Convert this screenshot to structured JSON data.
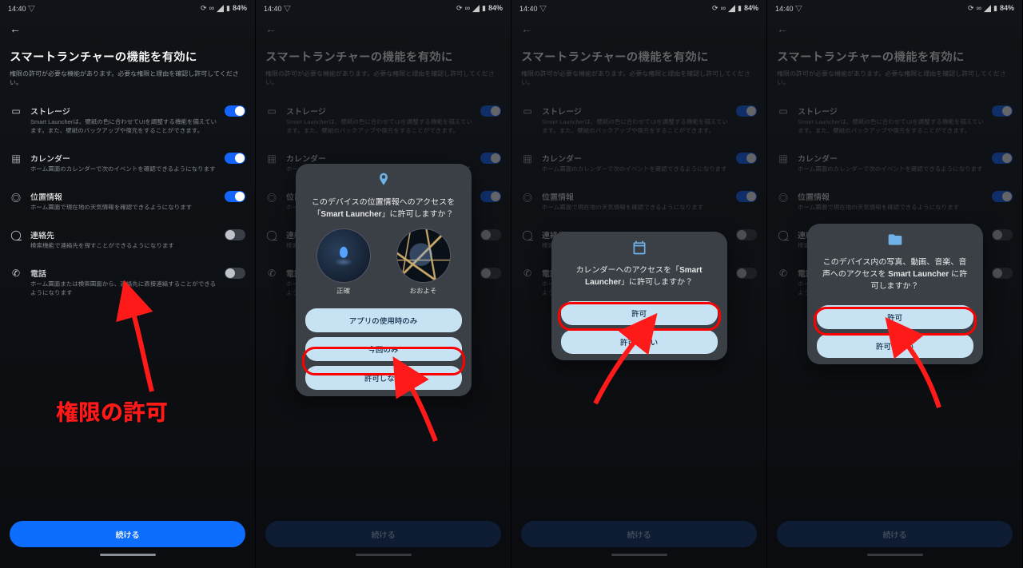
{
  "status": {
    "time": "14:40",
    "battery": "84%"
  },
  "header": {
    "title": "スマートランチャーの機能を有効に",
    "subtitle": "権限の許可が必要な機能があります。必要な権限と理由を確認し許可してください。"
  },
  "permissions": [
    {
      "key": "storage",
      "title": "ストレージ",
      "desc": "Smart Launcherは、壁紙の色に合わせてUIを調整する機能を備えています。また、壁紙のバックアップや復元をすることができます。",
      "on": true
    },
    {
      "key": "calendar",
      "title": "カレンダー",
      "desc": "ホーム画面のカレンダーで次のイベントを確認できるようになります",
      "on": true
    },
    {
      "key": "location",
      "title": "位置情報",
      "desc": "ホーム画面で現在地の天気情報を確認できるようになります",
      "on": true
    },
    {
      "key": "contacts",
      "title": "連絡先",
      "desc": "検索機能で連絡先を探すことができるようになります",
      "on": false
    },
    {
      "key": "phone",
      "title": "電話",
      "desc": "ホーム画面または検索画面から、連絡先に直接連絡することができるようになります",
      "on": false
    }
  ],
  "cta": {
    "label": "続ける"
  },
  "annotation": {
    "text": "権限の許可"
  },
  "dialog_location": {
    "title_pre": "このデバイスの位置情報へのアクセスを「",
    "app": "Smart Launcher",
    "title_post": "」に許可しますか？",
    "precise": "正確",
    "approx": "おおよそ",
    "btn1": "アプリの使用時のみ",
    "btn2": "今回のみ",
    "btn3": "許可しない"
  },
  "dialog_calendar": {
    "title_pre": "カレンダーへのアクセスを「",
    "app": "Smart Launcher",
    "title_post": "」に許可しますか？",
    "allow": "許可",
    "deny": "許可しない"
  },
  "dialog_storage": {
    "title_pre": "このデバイス内の写真、動画、音楽、音声へのアクセスを ",
    "app": "Smart Launcher",
    "title_post": " に許可しますか？",
    "allow": "許可",
    "deny": "許可しない"
  }
}
